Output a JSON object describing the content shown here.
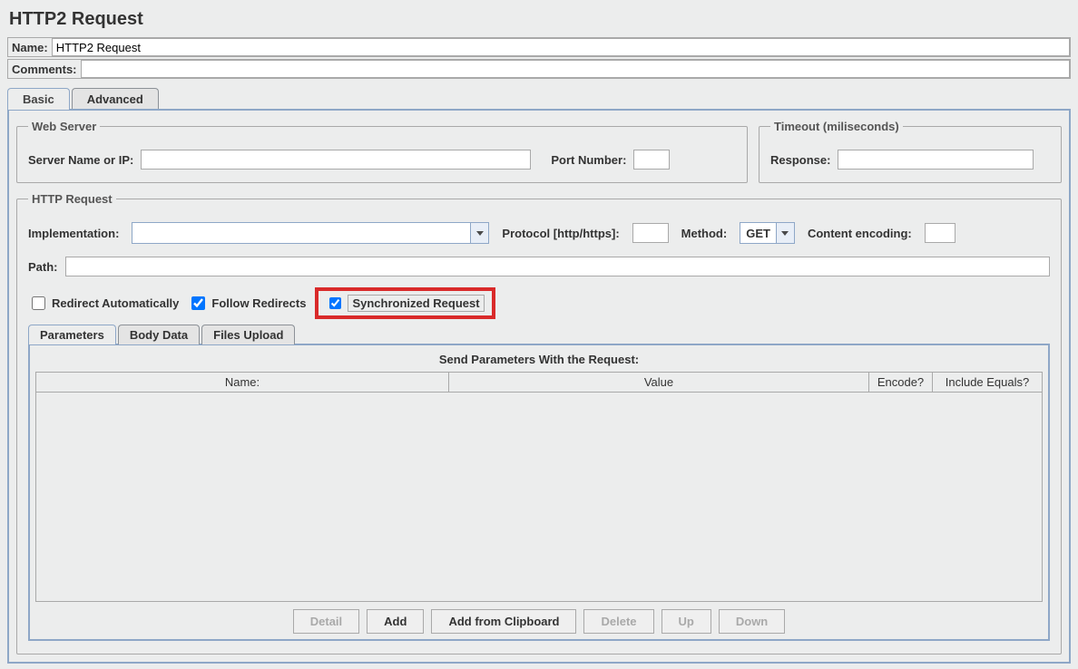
{
  "title": "HTTP2 Request",
  "name_row": {
    "label": "Name:",
    "value": "HTTP2 Request"
  },
  "comments_row": {
    "label": "Comments:",
    "value": ""
  },
  "tabs": {
    "basic": "Basic",
    "advanced": "Advanced"
  },
  "web_server": {
    "legend": "Web Server",
    "server_label": "Server Name or IP:",
    "server_value": "",
    "port_label": "Port Number:",
    "port_value": ""
  },
  "timeout": {
    "legend": "Timeout (miliseconds)",
    "response_label": "Response:",
    "response_value": ""
  },
  "http_request": {
    "legend": "HTTP Request",
    "impl_label": "Implementation:",
    "impl_value": "",
    "proto_label": "Protocol [http/https]:",
    "proto_value": "",
    "method_label": "Method:",
    "method_value": "GET",
    "enc_label": "Content encoding:",
    "enc_value": "",
    "path_label": "Path:",
    "path_value": "",
    "chk_redirect": "Redirect Automatically",
    "chk_follow": "Follow Redirects",
    "chk_sync": "Synchronized Request"
  },
  "inner_tabs": {
    "params": "Parameters",
    "body": "Body Data",
    "files": "Files Upload"
  },
  "params": {
    "title": "Send Parameters With the Request:",
    "cols": {
      "name": "Name:",
      "value": "Value",
      "encode": "Encode?",
      "include": "Include Equals?"
    }
  },
  "buttons": {
    "detail": "Detail",
    "add": "Add",
    "add_clip": "Add from Clipboard",
    "delete": "Delete",
    "up": "Up",
    "down": "Down"
  }
}
